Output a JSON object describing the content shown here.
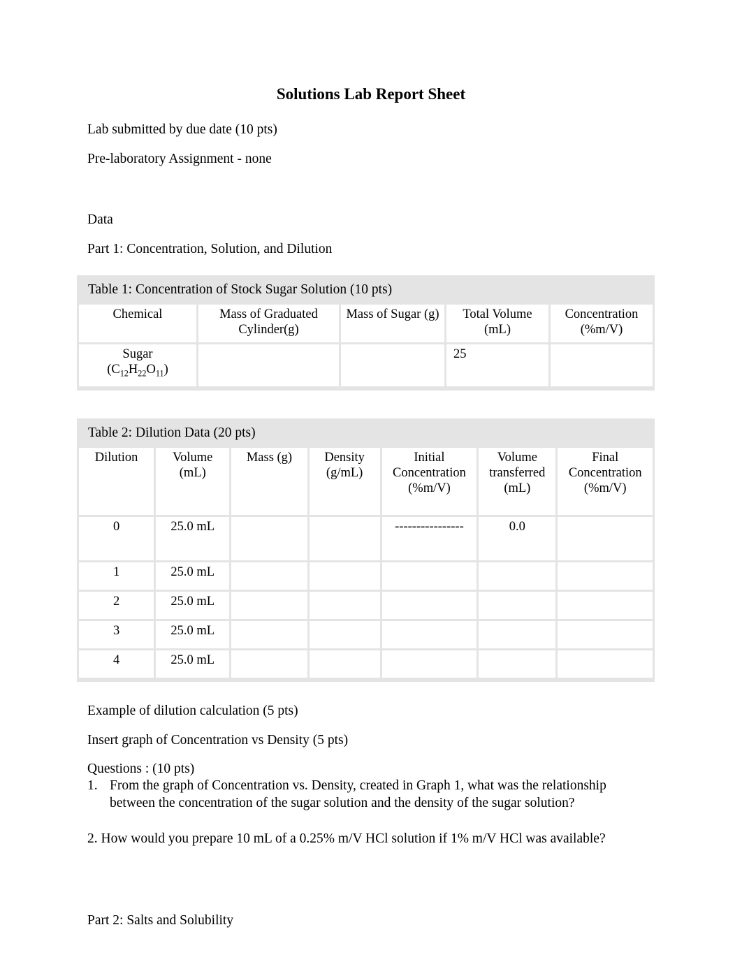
{
  "document": {
    "title": "Solutions Lab Report Sheet",
    "intro_lines": [
      "Lab submitted by due date (10 pts)",
      "Pre-laboratory Assignment - none"
    ],
    "data_heading": "Data",
    "part1_heading": "Part 1: Concentration, Solution, and Dilution",
    "part2_heading": "Part 2: Salts and Solubility",
    "example_line": "Example  of dilution calculation (5 pts)",
    "insert_line": "Insert  graph of Concentration vs Density (5 pts)",
    "questions_heading": "Questions : (10 pts)",
    "questions": [
      {
        "number": "1.",
        "text": "From the graph of Concentration vs. Density, created in Graph 1, what was the relationship between the concentration of the sugar solution and the density of the sugar solution?"
      }
    ],
    "question2_line": "2. How would you prepare 10 mL of a 0.25% m/V HCl solution if 1% m/V HCl was available?"
  },
  "table1": {
    "caption": "Table 1: Concentration of Stock Sugar Solution (10 pts)",
    "headers": [
      "Chemical",
      "Mass of Graduated Cylinder(g)",
      "Mass of Sugar (g)",
      "Total Volume (mL)",
      "Concentration (%m/V)"
    ],
    "rows": [
      {
        "chemical_name": "Sugar",
        "chemical_formula_prefix": "(C",
        "chemical_formula": "(C12H22O11)",
        "mass_cylinder": "",
        "mass_sugar": "",
        "total_volume": "25",
        "concentration": ""
      }
    ]
  },
  "table2": {
    "caption": "Table 2: Dilution Data (20 pts)",
    "headers": [
      "Dilution",
      "Volume (mL)",
      "Mass (g)",
      "Density (g/mL)",
      "Initial Concentration (%m/V)",
      "Volume transferred (mL)",
      "Final Concentration (%m/V)"
    ],
    "rows": [
      {
        "dilution": "0",
        "volume": "25.0 mL",
        "mass": "",
        "density": "",
        "initial_concentration": "----------------",
        "volume_transferred": "0.0",
        "final_concentration": ""
      },
      {
        "dilution": "1",
        "volume": "25.0 mL",
        "mass": "",
        "density": "",
        "initial_concentration": "",
        "volume_transferred": "",
        "final_concentration": ""
      },
      {
        "dilution": "2",
        "volume": "25.0 mL",
        "mass": "",
        "density": "",
        "initial_concentration": "",
        "volume_transferred": "",
        "final_concentration": ""
      },
      {
        "dilution": "3",
        "volume": "25.0 mL",
        "mass": "",
        "density": "",
        "initial_concentration": "",
        "volume_transferred": "",
        "final_concentration": ""
      },
      {
        "dilution": "4",
        "volume": "25.0 mL",
        "mass": "",
        "density": "",
        "initial_concentration": "",
        "volume_transferred": "",
        "final_concentration": ""
      }
    ]
  },
  "colors": {
    "page_background": "#ffffff",
    "table_band": "#e4e4e4",
    "cell_background": "#ffffff",
    "text": "#000000"
  }
}
